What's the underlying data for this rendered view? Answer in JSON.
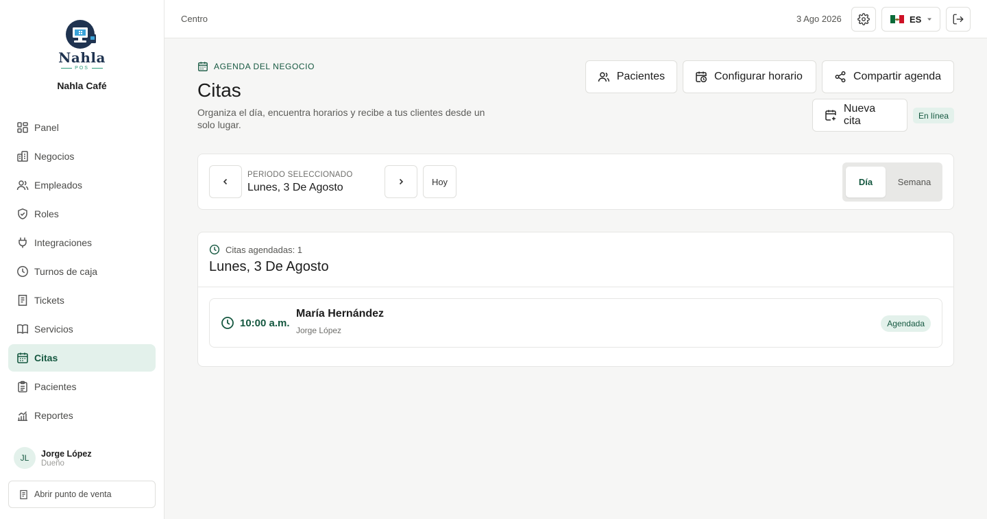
{
  "colors": {
    "accent": "#14573f",
    "accent_bg": "#e3f1eb",
    "logo_navy": "#1f3350"
  },
  "sidebar": {
    "logo_text": "Nahla",
    "logo_sub": "POS",
    "business_name": "Nahla Café",
    "items": [
      {
        "label": "Panel",
        "icon": "dashboard-icon"
      },
      {
        "label": "Negocios",
        "icon": "building-icon"
      },
      {
        "label": "Empleados",
        "icon": "users-icon"
      },
      {
        "label": "Roles",
        "icon": "shield-icon"
      },
      {
        "label": "Integraciones",
        "icon": "plug-icon"
      },
      {
        "label": "Turnos de caja",
        "icon": "clock-icon"
      },
      {
        "label": "Tickets",
        "icon": "receipt-icon"
      },
      {
        "label": "Servicios",
        "icon": "book-icon"
      },
      {
        "label": "Citas",
        "icon": "calendar-icon",
        "active": true
      },
      {
        "label": "Pacientes",
        "icon": "clipboard-icon"
      },
      {
        "label": "Reportes",
        "icon": "chart-icon"
      }
    ],
    "user": {
      "initials": "JL",
      "name": "Jorge López",
      "role": "Dueño"
    },
    "pos_button": "Abrir punto de venta"
  },
  "topbar": {
    "breadcrumb": "Centro",
    "date": "3 Ago 2026",
    "language": "ES"
  },
  "header": {
    "eyebrow": "AGENDA DEL NEGOCIO",
    "title": "Citas",
    "subtitle": "Organiza el día, encuentra horarios y recibe a tus clientes desde un solo lugar.",
    "buttons": {
      "patients": "Pacientes",
      "schedule": "Configurar horario",
      "share": "Compartir agenda",
      "new": "Nueva cita"
    },
    "status": "En línea"
  },
  "period": {
    "label": "PERIODO SELECCIONADO",
    "value": "Lunes, 3 De Agosto",
    "today": "Hoy",
    "views": [
      "Día",
      "Semana"
    ],
    "selected_view": "Día"
  },
  "appointments": {
    "count_text": "Citas agendadas: 1",
    "day_title": "Lunes, 3 De Agosto",
    "items": [
      {
        "time": "10:00 a.m.",
        "client": "María Hernández",
        "staff": "Jorge López",
        "status": "Agendada"
      }
    ]
  }
}
